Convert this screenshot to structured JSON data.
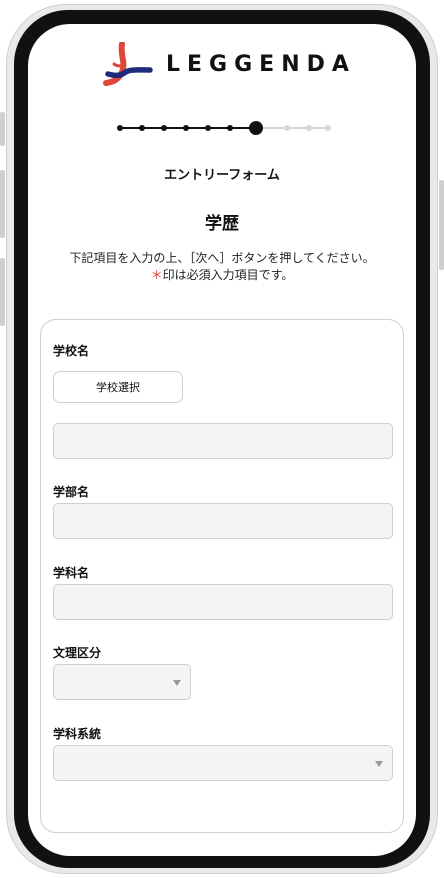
{
  "logo": {
    "text": "LEGGENDA"
  },
  "stepper": {
    "completed": 7,
    "current": 8,
    "total": 10
  },
  "form_title": "エントリーフォーム",
  "section_title": "学歴",
  "instruction": {
    "line1": "下記項目を入力の上、［次へ］ボタンを押してください。",
    "required_mark": "＊",
    "line2": "印は必須入力項目です。"
  },
  "fields": {
    "school": {
      "label": "学校名",
      "button_label": "学校選択",
      "value": ""
    },
    "faculty": {
      "label": "学部名",
      "value": ""
    },
    "department": {
      "label": "学科名",
      "value": ""
    },
    "track": {
      "label": "文理区分",
      "selected": ""
    },
    "major_category": {
      "label": "学科系統",
      "selected": ""
    }
  },
  "colors": {
    "required": "#e53935",
    "logo_red": "#e0473a",
    "logo_navy": "#1f2a7a",
    "field_bg": "#f4f4f4"
  }
}
